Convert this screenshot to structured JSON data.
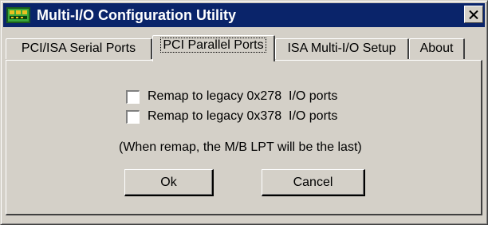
{
  "window": {
    "title": "Multi-I/O Configuration Utility",
    "icon": "chip-board-icon",
    "close_symbol": "✕"
  },
  "tabs": [
    {
      "label": "PCI/ISA Serial Ports",
      "active": false
    },
    {
      "label": "PCI Parallel Ports",
      "active": true
    },
    {
      "label": "ISA Multi-I/O Setup",
      "active": false
    },
    {
      "label": "About",
      "active": false
    }
  ],
  "panel": {
    "options": [
      {
        "label": "Remap to legacy 0x278  I/O ports",
        "checked": false
      },
      {
        "label": "Remap to legacy 0x378  I/O ports",
        "checked": false
      }
    ],
    "note": "(When remap, the M/B LPT will be the last)"
  },
  "buttons": {
    "ok": "Ok",
    "cancel": "Cancel"
  },
  "colors": {
    "titlebar": "#0a246a",
    "face": "#d4d0c8",
    "icon_green": "#3aa83a",
    "icon_yellow": "#e8c020"
  }
}
